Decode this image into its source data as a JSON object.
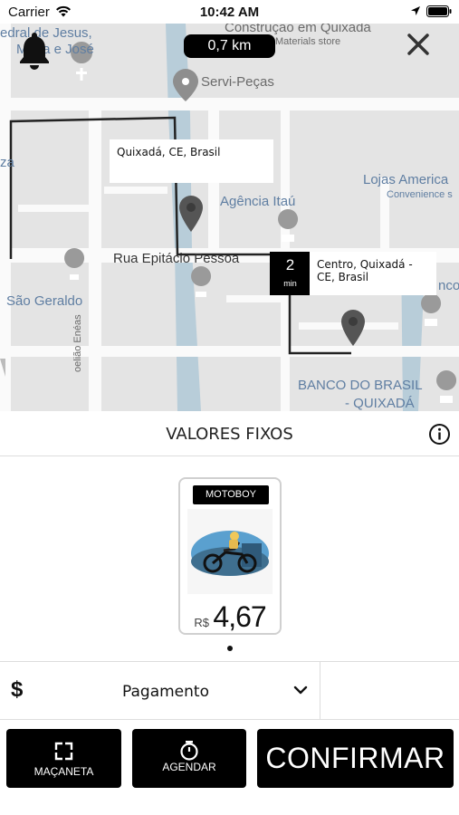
{
  "status_bar": {
    "carrier": "Carrier",
    "time": "10:42 AM"
  },
  "map": {
    "distance": "0,7 km",
    "labels": {
      "edra_de_jesus": "edral de Jesus,",
      "maria_e_jose": "Maria e José",
      "construcao": "Construção em Quixadá",
      "materials_store": "Materials store",
      "servi_pecas": "Servi-Peças",
      "za": "za",
      "lojas_americanas": "Lojas America",
      "convenience_store": "Convenience s",
      "agencia_itau": "Agência Itaú",
      "rua_epitacio": "Rua Epitácio Pessoa",
      "sao_geraldo": "São Geraldo",
      "nco": "nco",
      "banco_do_brasil": "BANCO DO BRASIL",
      "quixada": "- QUIXADÁ",
      "coelho_eneas": "oelião Enéas"
    },
    "origin_callout": "Quixadá, CE, Brasil",
    "dest_callout": "Centro, Quixadá - CE, Brasil",
    "eta_value": "2",
    "eta_unit": "min"
  },
  "fixed_values": {
    "title": "VALORES FIXOS"
  },
  "vehicle_card": {
    "tag": "MOTOBOY",
    "currency": "R$",
    "price": "4,67"
  },
  "payment": {
    "currency_symbol": "$",
    "label": "Pagamento"
  },
  "actions": {
    "macaneta_label": "MAÇANETA",
    "agendar_label": "AGENDAR",
    "confirm_label": "CONFIRMAR"
  },
  "colors": {
    "accent": "#000000",
    "map_bg": "#e6e6e6",
    "river": "#b8cdd9",
    "poi_blue": "#5f7ea2"
  }
}
